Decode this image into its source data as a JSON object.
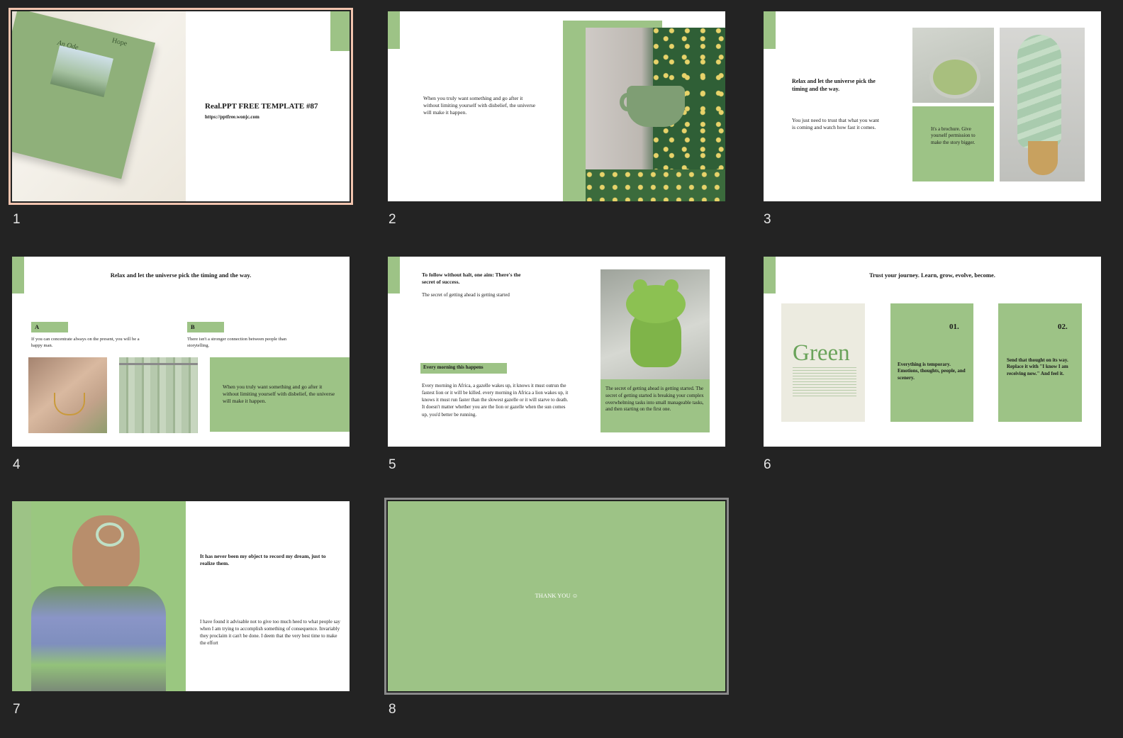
{
  "slides": [
    {
      "number": "1",
      "book_title": "Hope",
      "book_subtitle": "An Ode",
      "title": "Real.PPT FREE TEMPLATE #87",
      "url": "https://pptfree.wonjc.com"
    },
    {
      "number": "2",
      "body": "When you truly want something and go after it without limiting yourself  with disbelief, the universe will make it happen."
    },
    {
      "number": "3",
      "heading": "Relax and let the universe pick the timing and the way.",
      "body": "You just need to trust that what you want is coming and watch how fast it comes.",
      "box": "It's a brochure. Give yourself permission to make the story bigger."
    },
    {
      "number": "4",
      "heading": "Relax and let the universe pick the timing and the way.",
      "label_a": "A",
      "text_a": "If you can concentrate always on the present, you will be a happy man.",
      "label_b": "B",
      "text_b": "There isn't a stronger connection between people than storytelling.",
      "box": "When you truly want something and go after it without limiting yourself  with disbelief, the universe will make it happen."
    },
    {
      "number": "5",
      "heading": "To follow without halt, one aim: There's the secret of success.",
      "subheading": "The secret of  getting ahead is getting started",
      "label": "Every morning this happens",
      "body": "Every morning in Africa, a gazelle wakes up, it knows it must outrun the fastest lion or it will be killed. every morning in Africa a lion wakes up, it knows it must run faster than the slowest gazelle or it will starve to death. It doesn't matter whether you are the lion or gazelle when the sun comes up, you'd better be running.",
      "box": "The secret of  getting ahead is getting started. The secret of  getting started is breaking your complex overwhelming tasks into small manageable tasks, and then starting on the first one."
    },
    {
      "number": "6",
      "heading": "Trust your journey. Learn, grow, evolve, become.",
      "book_word": "Green",
      "card1_num": "01.",
      "card1_text": "Everything is temporary. Emotions, thoughts, people, and scenery.",
      "card2_num": "02.",
      "card2_text": "Send that thought on its way. Replace it with \"I know I am receiving now.\" And feel it."
    },
    {
      "number": "7",
      "heading": "It has never been my object to record my dream, just to realize them.",
      "body": "I have found it advisable not to give too much heed to what people say when I am trying to accomplish something of  consequence. Invariably they proclaim it can't be done. I deem that the very best time to make the effort"
    },
    {
      "number": "8",
      "text": "THANK YOU ☺"
    }
  ],
  "colors": {
    "accent": "#9dc386",
    "background": "#232323",
    "selection": "#f2c4ae"
  }
}
